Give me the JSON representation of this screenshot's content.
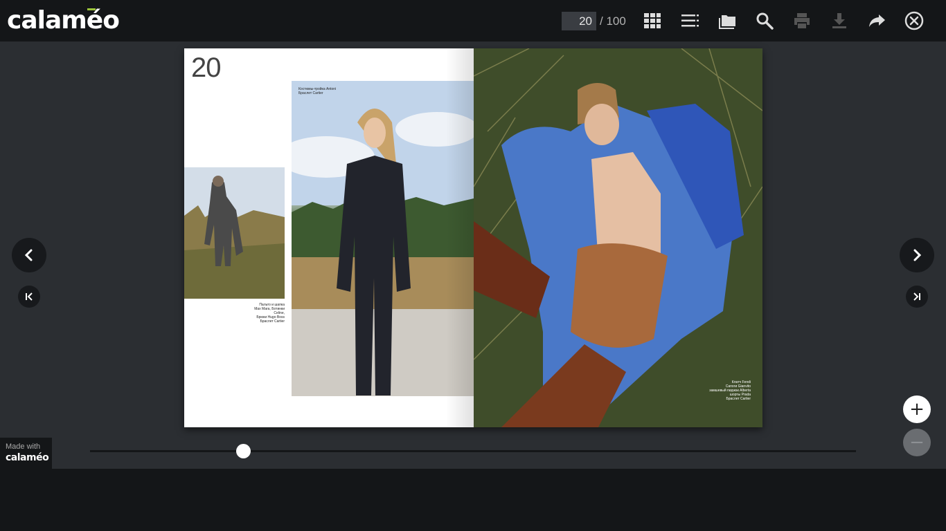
{
  "brand": {
    "logo_text": "calaméo",
    "accent_color": "#9bc43a"
  },
  "toolbar": {
    "page_current": "20",
    "page_total": "/ 100",
    "icons": [
      "grid-icon",
      "list-icon",
      "folder-icon",
      "search-icon",
      "print-icon",
      "download-icon",
      "share-icon",
      "close-icon"
    ]
  },
  "document": {
    "left_page_number": "20",
    "caption_top": "Костюмы-тройка Antoni\nБраслет Cartier",
    "caption_left": "Пальто и шапка\nMax Mara, Ботинки Celine,\nБрюки Hugo Boss\nБраслет Cartier",
    "caption_right": "Клатч Fendi\nСапоги Gianvito\nзамшевый пиджак Alberta\nшорты Prada\nБраслет Cartier"
  },
  "zoom": {
    "in_label": "+",
    "out_label": "−"
  },
  "slider": {
    "position_fraction": 0.2
  },
  "footer": {
    "made_with": "Made with",
    "made_logo": "calaméo"
  }
}
